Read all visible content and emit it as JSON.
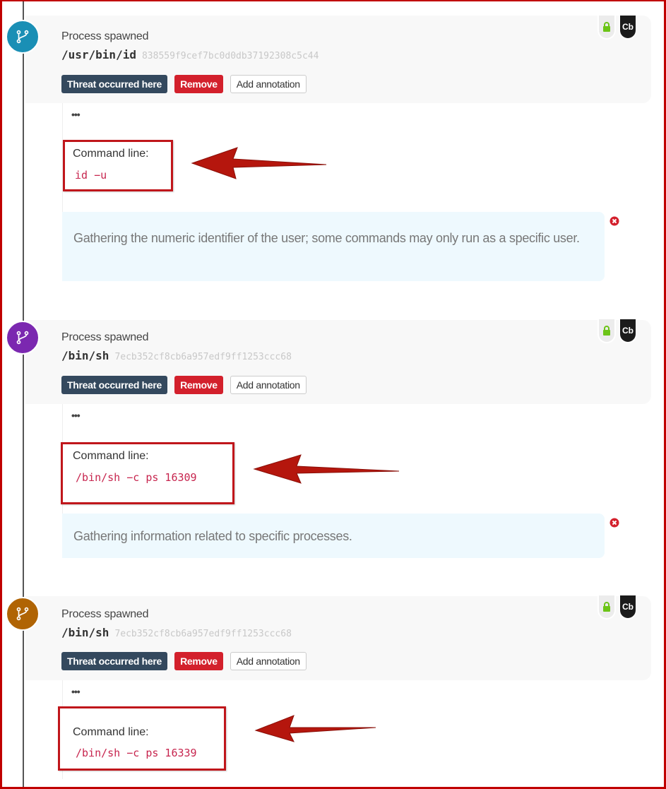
{
  "events": [
    {
      "title": "Process spawned",
      "path": "/usr/bin/id",
      "hash": "838559f9cef7bc0d0db37192308c5c44",
      "node_color": "#1a8fb5",
      "buttons": {
        "threat": "Threat occurred here",
        "remove": "Remove",
        "annotate": "Add annotation"
      },
      "badges": {
        "lock": "lock-icon",
        "cb": "Cb"
      },
      "more": "•••",
      "command_label": "Command line:",
      "command_value": "id −u",
      "note": "Gathering the numeric identifier of the user; some commands may only run as a specific user."
    },
    {
      "title": "Process spawned",
      "path": "/bin/sh",
      "hash": "7ecb352cf8cb6a957edf9ff1253ccc68",
      "node_color": "#7b28b0",
      "buttons": {
        "threat": "Threat occurred here",
        "remove": "Remove",
        "annotate": "Add annotation"
      },
      "badges": {
        "lock": "lock-icon",
        "cb": "Cb"
      },
      "more": "•••",
      "command_label": "Command line:",
      "command_value": "/bin/sh −c ps 16309",
      "note": "Gathering information related to specific processes."
    },
    {
      "title": "Process spawned",
      "path": "/bin/sh",
      "hash": "7ecb352cf8cb6a957edf9ff1253ccc68",
      "node_color": "#b06404",
      "buttons": {
        "threat": "Threat occurred here",
        "remove": "Remove",
        "annotate": "Add annotation"
      },
      "badges": {
        "lock": "lock-icon",
        "cb": "Cb"
      },
      "more": "•••",
      "command_label": "Command line:",
      "command_value": "/bin/sh −c ps 16339"
    }
  ],
  "colors": {
    "annotation_red": "#c0161b",
    "threat_btn": "#34495e",
    "remove_btn": "#d3202c",
    "lock_green": "#6cc417",
    "note_bg": "#eef9fe"
  }
}
